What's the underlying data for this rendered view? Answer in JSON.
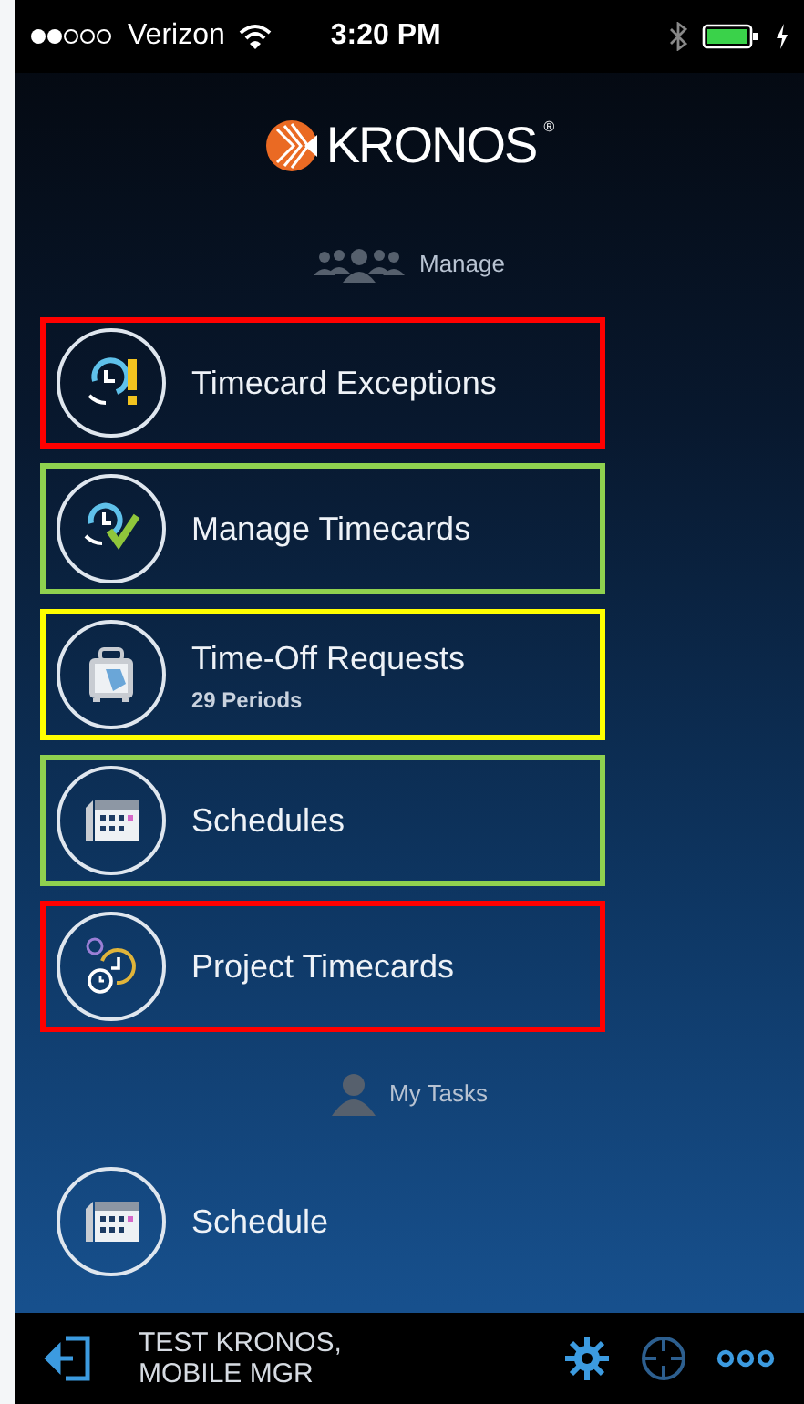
{
  "status_bar": {
    "carrier": "Verizon",
    "time": "3:20 PM"
  },
  "logo": {
    "name": "KRONOS",
    "mark": "®"
  },
  "sections": [
    {
      "title": "Manage",
      "kind": "group",
      "items": [
        {
          "label": "Timecard Exceptions",
          "kind": "exceptions",
          "color": "#ff0000"
        },
        {
          "label": "Manage Timecards",
          "kind": "approval",
          "color": "#8fd14f"
        },
        {
          "label": "Time-Off Requests",
          "subtitle": "29 Periods",
          "kind": "timeoff",
          "color": "#ffff00"
        },
        {
          "label": "Schedules",
          "kind": "schedule",
          "color": "#8fd14f"
        },
        {
          "label": "Project Timecards",
          "kind": "project",
          "color": "#ff0000"
        }
      ]
    },
    {
      "title": "My Tasks",
      "kind": "person",
      "items": [
        {
          "label": "Schedule",
          "kind": "schedule"
        }
      ]
    }
  ],
  "footer": {
    "user_lines": [
      "TEST KRONOS,",
      "MOBILE MGR"
    ]
  }
}
